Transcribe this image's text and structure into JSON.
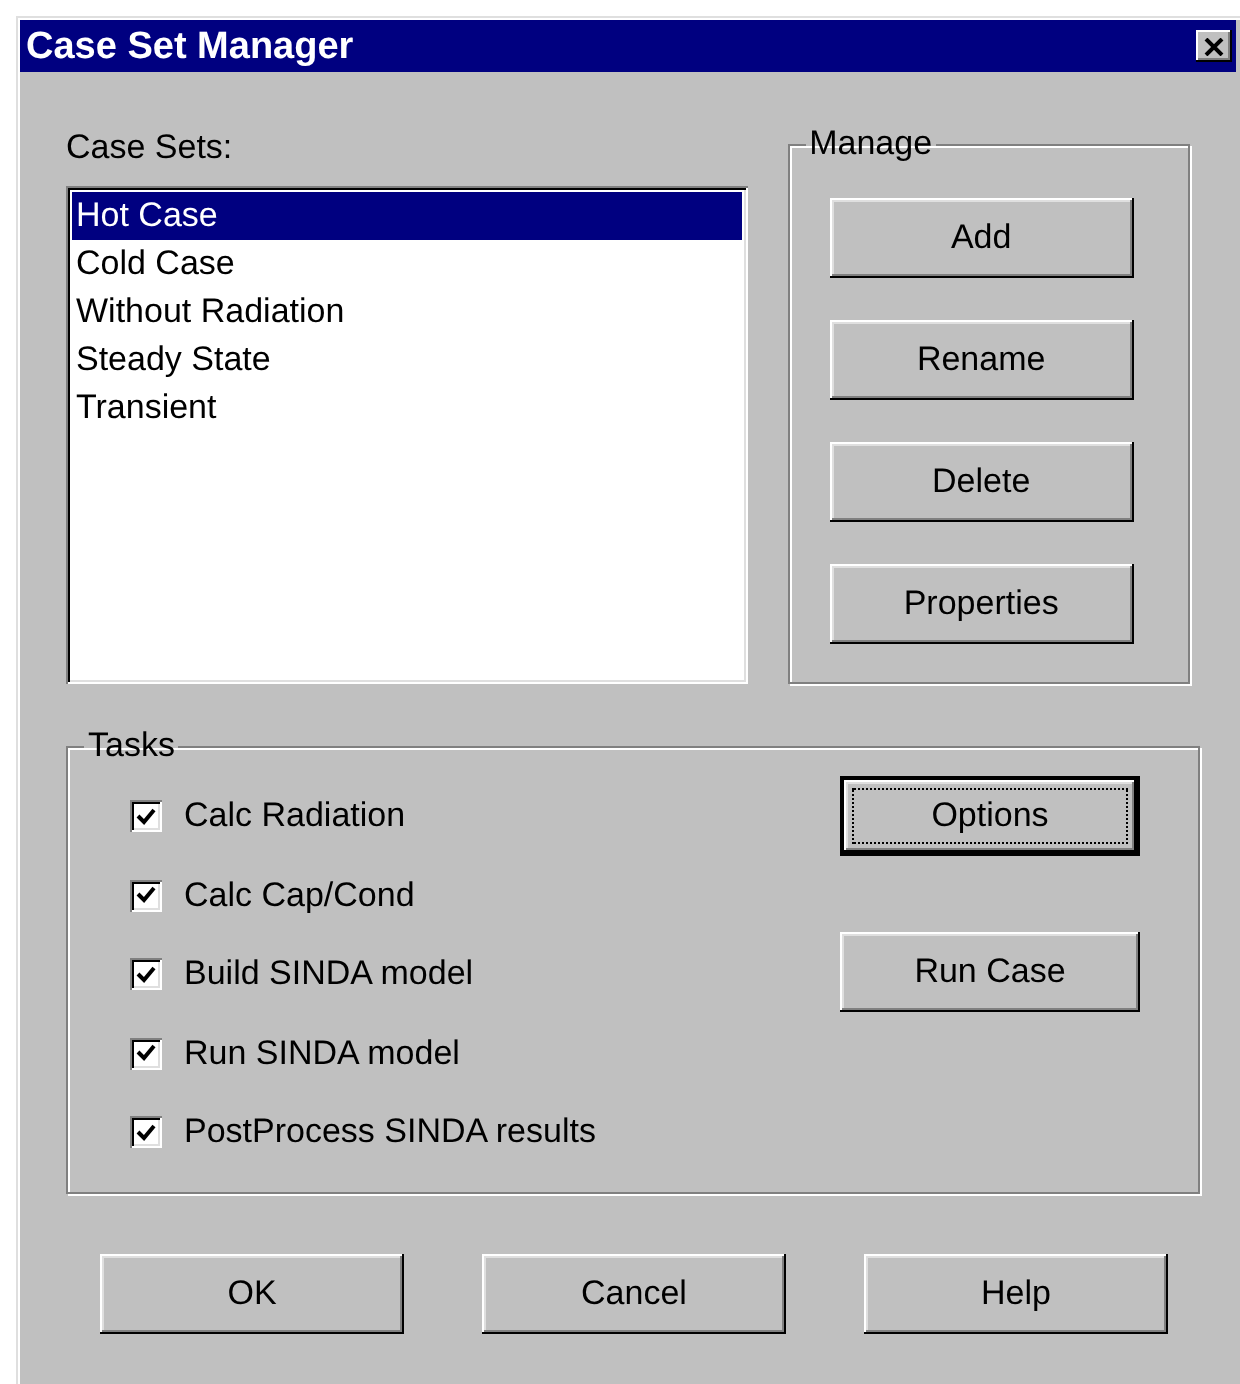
{
  "window": {
    "title": "Case Set Manager"
  },
  "case_sets": {
    "label": "Case Sets:",
    "items": [
      {
        "label": "Hot Case",
        "selected": true
      },
      {
        "label": "Cold Case",
        "selected": false
      },
      {
        "label": "Without Radiation",
        "selected": false
      },
      {
        "label": "Steady State",
        "selected": false
      },
      {
        "label": "Transient",
        "selected": false
      }
    ]
  },
  "manage": {
    "title": "Manage",
    "buttons": [
      "Add",
      "Rename",
      "Delete",
      "Properties"
    ]
  },
  "tasks": {
    "title": "Tasks",
    "items": [
      {
        "label": "Calc Radiation",
        "checked": true
      },
      {
        "label": "Calc Cap/Cond",
        "checked": true
      },
      {
        "label": "Build SINDA model",
        "checked": true
      },
      {
        "label": "Run SINDA model",
        "checked": true
      },
      {
        "label": "PostProcess SINDA results",
        "checked": true
      }
    ],
    "buttons": [
      {
        "label": "Options",
        "focused": true
      },
      {
        "label": "Run Case",
        "focused": false
      }
    ]
  },
  "buttons": [
    "OK",
    "Cancel",
    "Help"
  ]
}
